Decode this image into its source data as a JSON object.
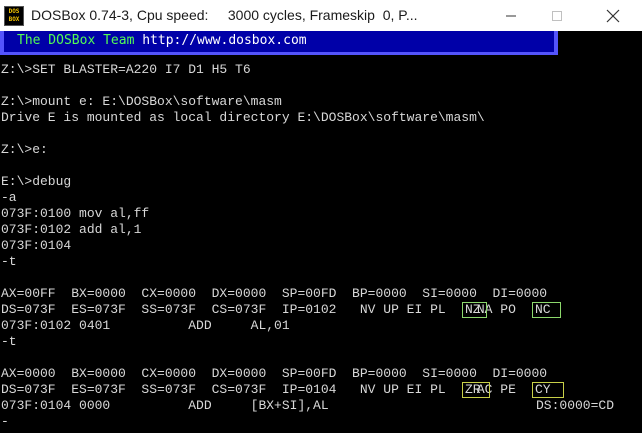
{
  "window": {
    "title": "DOSBox 0.74-3, Cpu speed:     3000 cycles, Frameskip  0, P...",
    "icon_text": [
      "DOS",
      "BOX"
    ]
  },
  "banner": {
    "part1": "The DOSBox Team ",
    "part2": "http://www.dosbox.com"
  },
  "console": {
    "lines": [
      "Z:\\>SET BLASTER=A220 I7 D1 H5 T6",
      "",
      "Z:\\>mount e: E:\\DOSBox\\software\\masm",
      "Drive E is mounted as local directory E:\\DOSBox\\software\\masm\\",
      "",
      "Z:\\>e:",
      "",
      "E:\\>debug",
      "-a",
      "073F:0100 mov al,ff",
      "073F:0102 add al,1",
      "073F:0104",
      "-t",
      "",
      "AX=00FF  BX=0000  CX=0000  DX=0000  SP=00FD  BP=0000  SI=0000  DI=0000",
      "DS=073F  ES=073F  SS=073F  CS=073F  IP=0102   NV UP EI PL    NA PO   ",
      "073F:0102 0401          ADD     AL,01",
      "-t",
      "",
      "AX=0000  BX=0000  CX=0000  DX=0000  SP=00FD  BP=0000  SI=0000  DI=0000",
      "DS=073F  ES=073F  SS=073F  CS=073F  IP=0104   NV UP EI PL    AC PE   ",
      "073F:0104 0000          ADD     [BX+SI],AL",
      "-"
    ],
    "flags1": {
      "zero": "NZ",
      "carry": "NC"
    },
    "flags2": {
      "zero": "ZR",
      "carry": "CY"
    },
    "mem_ref": "DS:0000=CD"
  }
}
